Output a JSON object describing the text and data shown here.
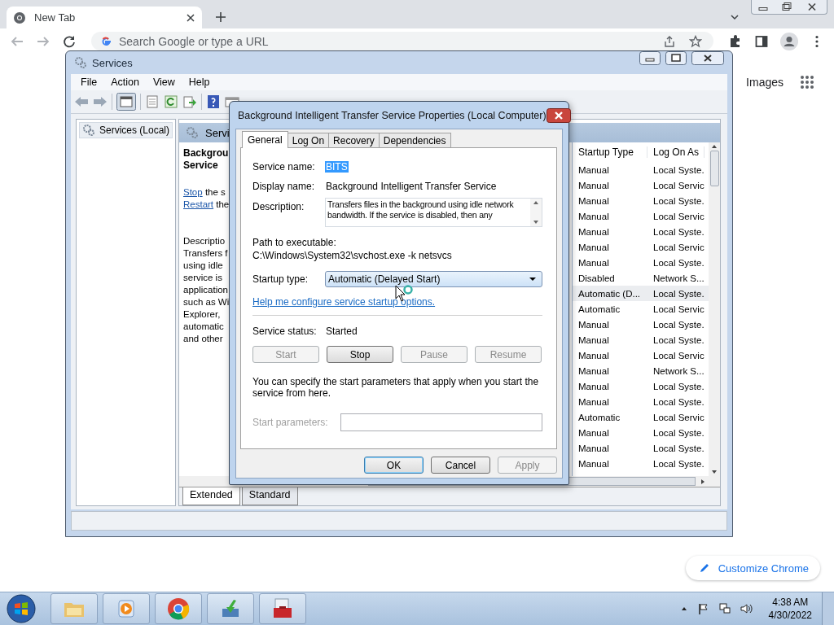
{
  "browser": {
    "tabs": [
      {
        "title": "New Tab",
        "selected": true
      }
    ],
    "omnibox": {
      "placeholder": "Search Google or type a URL"
    },
    "links": [
      "Images"
    ],
    "customize_button": "Customize Chrome"
  },
  "services_window": {
    "title": "Services",
    "menu": [
      "File",
      "Action",
      "View",
      "Help"
    ],
    "tree": [
      {
        "label": "Services (Local)",
        "selected": true
      }
    ],
    "pane_header": "Servi",
    "detail": {
      "title_lines": [
        "Backgrou",
        "Service"
      ],
      "actions": [
        {
          "link": "Stop",
          "rest": "the s"
        },
        {
          "link": "Restart",
          "rest": "the"
        }
      ],
      "description_lines": [
        "Descriptio",
        "Transfers f",
        "using idle",
        "service is",
        "application",
        "such as Wi",
        "Explorer,",
        "automatic",
        "and other"
      ]
    },
    "table": {
      "columns": [
        "Startup Type",
        "Log On As"
      ],
      "rows": [
        {
          "startup_type": "Manual",
          "log_on_as": "Local Syste.",
          "selected": false
        },
        {
          "startup_type": "Manual",
          "log_on_as": "Local Servic",
          "selected": false
        },
        {
          "startup_type": "Manual",
          "log_on_as": "Local Syste.",
          "selected": false
        },
        {
          "startup_type": "Manual",
          "log_on_as": "Local Servic",
          "selected": false
        },
        {
          "startup_type": "Manual",
          "log_on_as": "Local Syste.",
          "selected": false
        },
        {
          "startup_type": "Manual",
          "log_on_as": "Local Servic",
          "selected": false
        },
        {
          "startup_type": "Manual",
          "log_on_as": "Local Syste.",
          "selected": false
        },
        {
          "startup_type": "Disabled",
          "log_on_as": "Network S...",
          "selected": false
        },
        {
          "startup_type": "Automatic (D...",
          "log_on_as": "Local Syste.",
          "selected": true
        },
        {
          "startup_type": "Automatic",
          "log_on_as": "Local Servic",
          "selected": false
        },
        {
          "startup_type": "Manual",
          "log_on_as": "Local Syste.",
          "selected": false
        },
        {
          "startup_type": "Manual",
          "log_on_as": "Local Syste.",
          "selected": false
        },
        {
          "startup_type": "Manual",
          "log_on_as": "Local Servic",
          "selected": false
        },
        {
          "startup_type": "Manual",
          "log_on_as": "Network S...",
          "selected": false
        },
        {
          "startup_type": "Manual",
          "log_on_as": "Local Syste.",
          "selected": false
        },
        {
          "startup_type": "Manual",
          "log_on_as": "Local Syste.",
          "selected": false
        },
        {
          "startup_type": "Automatic",
          "log_on_as": "Local Servic",
          "selected": false
        },
        {
          "startup_type": "Manual",
          "log_on_as": "Local Syste.",
          "selected": false
        },
        {
          "startup_type": "Manual",
          "log_on_as": "Local Syste.",
          "selected": false
        },
        {
          "startup_type": "Manual",
          "log_on_as": "Local Syste.",
          "selected": false
        }
      ]
    },
    "view_tabs": [
      {
        "label": "Extended",
        "selected": true
      },
      {
        "label": "Standard",
        "selected": false
      }
    ]
  },
  "dialog": {
    "title": "Background Intelligent Transfer Service Properties (Local Computer)",
    "tabs": [
      {
        "label": "General",
        "selected": true
      },
      {
        "label": "Log On",
        "selected": false
      },
      {
        "label": "Recovery",
        "selected": false
      },
      {
        "label": "Dependencies",
        "selected": false
      }
    ],
    "service_name": {
      "label": "Service name:",
      "value": "BITS",
      "highlighted": true
    },
    "display_name": {
      "label": "Display name:",
      "value": "Background Intelligent Transfer Service"
    },
    "description": {
      "label": "Description:",
      "value": "Transfers files in the background using idle network bandwidth. If the service is disabled, then any"
    },
    "path": {
      "label": "Path to executable:",
      "value": "C:\\Windows\\System32\\svchost.exe -k netsvcs"
    },
    "startup_type": {
      "label": "Startup type:",
      "value": "Automatic (Delayed Start)"
    },
    "help_link": "Help me configure service startup options.",
    "service_status": {
      "label": "Service status:",
      "value": "Started"
    },
    "control_buttons": [
      {
        "label": "Start",
        "disabled": true
      },
      {
        "label": "Stop",
        "disabled": false
      },
      {
        "label": "Pause",
        "disabled": true
      },
      {
        "label": "Resume",
        "disabled": true
      }
    ],
    "params_note": "You can specify the start parameters that apply when you start the service from here.",
    "start_parameters": {
      "label": "Start parameters:",
      "disabled": true
    },
    "buttons": [
      {
        "label": "OK",
        "disabled": false,
        "default": true
      },
      {
        "label": "Cancel",
        "disabled": false,
        "default": false
      },
      {
        "label": "Apply",
        "disabled": true,
        "default": false
      }
    ]
  },
  "taskbar": {
    "time": "4:38 AM",
    "date": "4/30/2022"
  }
}
